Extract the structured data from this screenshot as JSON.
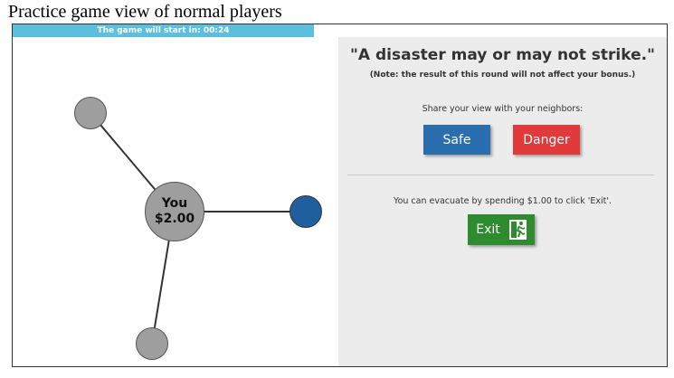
{
  "caption": "Practice game view of normal players",
  "timer": {
    "text": "The game will start in: 00:24"
  },
  "network": {
    "self_label": "You",
    "self_amount": "$2.00"
  },
  "panel": {
    "headline": "\"A disaster may or may not strike.\"",
    "note": "(Note: the result of this round will not affect your bonus.)",
    "share_prompt": "Share your view with your neighbors:",
    "safe_label": "Safe",
    "danger_label": "Danger",
    "evacuate_prompt": "You can evacuate by spending $1.00 to click 'Exit'.",
    "exit_label": "Exit"
  },
  "colors": {
    "progress": "#5bc0de",
    "safe": "#2a6eaf",
    "danger": "#e03a3a",
    "exit": "#2e8b2e",
    "neighbor_blue": "#1f5f9e",
    "neighbor_gray": "#9e9e9e"
  },
  "icons": {
    "exit": "running-man-exit-icon"
  }
}
